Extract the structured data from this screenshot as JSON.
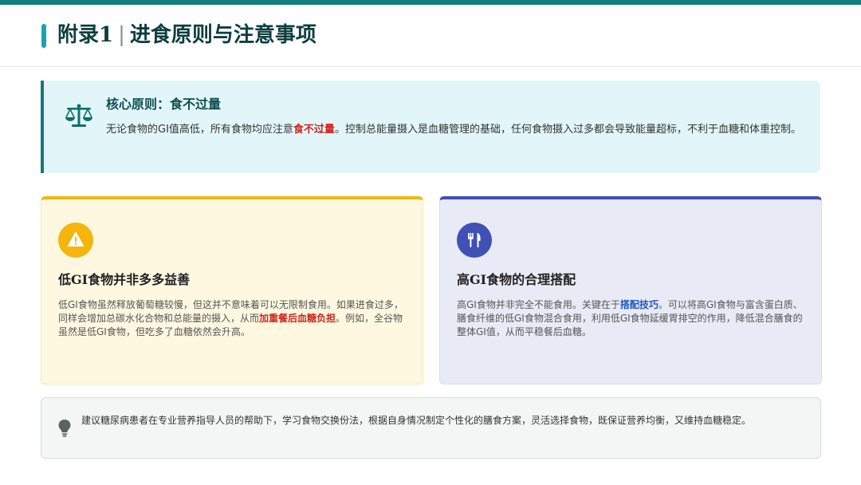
{
  "header": {
    "title_prefix": "附录1",
    "separator": "|",
    "title_main": "进食原则与注意事项"
  },
  "principle": {
    "icon": "balance-scale-icon",
    "title": "核心原则：食不过量",
    "text_before": "无论食物的GI值高低，所有食物均应注意",
    "highlight": "食不过量",
    "text_after": "。控制总能量摄入是血糖管理的基础，任何食物摄入过多都会导致能量超标，不利于血糖和体重控制。"
  },
  "cards": [
    {
      "icon": "warning-icon",
      "title": "低GI食物并非多多益善",
      "text_before": "低GI食物虽然释放葡萄糖较慢，但这并不意味着可以无限制食用。如果进食过多，同样会增加总碳水化合物和总能量的摄入，从而",
      "highlight": "加重餐后血糖负担",
      "text_after": "。例如，全谷物虽然是低GI食物，但吃多了血糖依然会升高。"
    },
    {
      "icon": "utensils-icon",
      "title": "高GI食物的合理搭配",
      "text_before": "高GI食物并非完全不能食用。关键在于",
      "highlight": "搭配技巧",
      "text_after": "。可以将高GI食物与富含蛋白质、膳食纤维的低GI食物混合食用，利用低GI食物延缓胃排空的作用，降低混合膳食的整体GI值，从而平稳餐后血糖。"
    }
  ],
  "tip": {
    "icon": "lightbulb-icon",
    "text": "建议糖尿病患者在专业营养指导人员的帮助下，学习食物交换份法，根据自身情况制定个性化的膳食方案，灵活选择食物，既保证营养均衡，又维持血糖稳定。"
  },
  "colors": {
    "top_bar": "#117f80",
    "accent": "#14a5b0",
    "principle_bg": "#e2f6fa",
    "highlight_red": "#d0251c",
    "highlight_blue": "#1d54c8",
    "warning_card_accent": "#f5b50d",
    "warning_card_bg": "#fff8e1",
    "pairing_card_accent": "#3f4fb8",
    "pairing_card_bg": "#e8eaf6"
  }
}
